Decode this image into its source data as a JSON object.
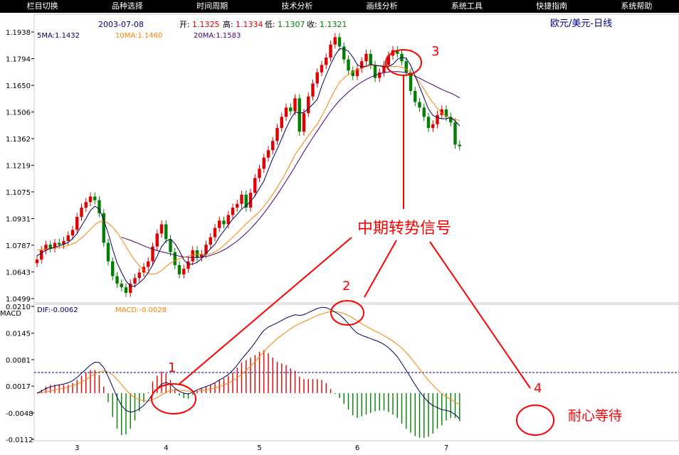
{
  "menu": [
    {
      "label": "栏目切换"
    },
    {
      "label": "品种选择"
    },
    {
      "label": "时间周期"
    },
    {
      "label": "技术分析"
    },
    {
      "label": "画线分析"
    },
    {
      "label": "系统工具"
    },
    {
      "label": "快捷指南"
    },
    {
      "label": "系统帮助"
    }
  ],
  "header": {
    "date": "2003-07-08",
    "open_label": "开:",
    "open_value": "1.1325",
    "high_label": "高:",
    "high_value": "1.1334",
    "low_label": "低:",
    "low_value": "1.1307",
    "close_label": "收:",
    "close_value": "1.1321",
    "title": "欧元/美元-日线"
  },
  "ma_legend": {
    "ma5": "5MA:1.1432",
    "ma10": "10MA:1.1460",
    "ma20": "20MA:1.1583"
  },
  "macd_legend": {
    "name": "MACD",
    "dif": "DIF:-0.0062",
    "macd": "MACD:-0.0028"
  },
  "annotations": {
    "signal_label": "中期转势信号",
    "wait_label": "耐心等待",
    "marker_1": "1",
    "marker_2": "2",
    "marker_3": "3",
    "marker_4": "4"
  },
  "colors": {
    "background": "#ffffff",
    "up_candle": "#e00000",
    "down_candle": "#008000",
    "ma5": "#000060",
    "ma10": "#ff8000",
    "ma20": "#400080",
    "dif": "#000060",
    "dea": "#ff8000",
    "annotation": "#ff0000",
    "grid": "#c8c8c8"
  },
  "chart_data": {
    "type": "candlestick",
    "price_axis": {
      "ticks": [
        "1.1938",
        "1.1794",
        "1.1650",
        "1.1506",
        "1.1362",
        "1.1219",
        "1.1075",
        "1.0931",
        "1.0787",
        "1.0643",
        "1.0499"
      ],
      "range": [
        1.0499,
        1.1938
      ]
    },
    "macd_axis": {
      "ticks": [
        "0.0210",
        "0.0145",
        "0.0081",
        "0.0017",
        "-0.0048",
        "-0.0112"
      ],
      "range": [
        -0.0112,
        0.021
      ]
    },
    "x_ticks": [
      "3",
      "4",
      "5",
      "6",
      "7"
    ],
    "x_tick_index": [
      9,
      29,
      50,
      72,
      92
    ],
    "close": [
      1.071,
      1.076,
      1.079,
      1.077,
      1.08,
      1.079,
      1.081,
      1.084,
      1.087,
      1.094,
      1.099,
      1.102,
      1.105,
      1.103,
      1.096,
      1.08,
      1.07,
      1.062,
      1.058,
      1.056,
      1.053,
      1.058,
      1.061,
      1.064,
      1.067,
      1.07,
      1.078,
      1.085,
      1.09,
      1.082,
      1.075,
      1.068,
      1.063,
      1.066,
      1.07,
      1.076,
      1.072,
      1.074,
      1.079,
      1.083,
      1.088,
      1.092,
      1.09,
      1.095,
      1.099,
      1.101,
      1.106,
      1.099,
      1.107,
      1.115,
      1.12,
      1.126,
      1.13,
      1.135,
      1.142,
      1.148,
      1.153,
      1.151,
      1.158,
      1.14,
      1.15,
      1.159,
      1.166,
      1.172,
      1.176,
      1.18,
      1.187,
      1.191,
      1.186,
      1.179,
      1.173,
      1.17,
      1.174,
      1.178,
      1.182,
      1.176,
      1.169,
      1.172,
      1.176,
      1.181,
      1.184,
      1.182,
      1.178,
      1.172,
      1.162,
      1.156,
      1.153,
      1.148,
      1.142,
      1.144,
      1.149,
      1.152,
      1.148,
      1.145,
      1.133,
      1.1321
    ],
    "ma5": [
      1.073,
      1.0745,
      1.076,
      1.077,
      1.0776,
      1.0784,
      1.0792,
      1.0802,
      1.0822,
      1.085,
      1.0892,
      1.0932,
      1.0974,
      1.0998,
      1.0982,
      1.0922,
      1.0852,
      1.0766,
      1.0692,
      1.064,
      1.0594,
      1.0566,
      1.0566,
      1.0584,
      1.0606,
      1.064,
      1.068,
      1.0728,
      1.078,
      1.081,
      1.082,
      1.0796,
      1.0756,
      1.0708,
      1.0684,
      1.0686,
      1.0694,
      1.0716,
      1.0742,
      1.0768,
      1.0792,
      1.0832,
      1.0864,
      1.0896,
      1.0928,
      1.0954,
      1.0982,
      1.1,
      1.1024,
      1.1054,
      1.1094,
      1.1134,
      1.1196,
      1.1256,
      1.1306,
      1.1362,
      1.1418,
      1.1468,
      1.1506,
      1.15,
      1.1504,
      1.1524,
      1.1548,
      1.1574,
      1.1646,
      1.1706,
      1.1762,
      1.1812,
      1.1848,
      1.1846,
      1.1834,
      1.1802,
      1.1762,
      1.1748,
      1.1754,
      1.1764,
      1.1758,
      1.1754,
      1.175,
      1.1752,
      1.1764,
      1.179,
      1.1802,
      1.1796,
      1.1758,
      1.17,
      1.1642,
      1.1582,
      1.1522,
      1.1488,
      1.1476,
      1.147,
      1.147,
      1.1476,
      1.1458,
      1.1432
    ],
    "ma10": [
      1.076,
      1.0762,
      1.0766,
      1.0768,
      1.0772,
      1.0776,
      1.078,
      1.0786,
      1.0794,
      1.0806,
      1.0826,
      1.0848,
      1.0872,
      1.0898,
      1.0914,
      1.0918,
      1.0906,
      1.0884,
      1.0856,
      1.082,
      1.078,
      1.074,
      1.0706,
      1.0676,
      1.0652,
      1.0634,
      1.063,
      1.0636,
      1.065,
      1.0672,
      1.069,
      1.0704,
      1.0714,
      1.0722,
      1.0728,
      1.0734,
      1.0738,
      1.0738,
      1.0736,
      1.074,
      1.075,
      1.0766,
      1.0786,
      1.0808,
      1.083,
      1.0854,
      1.0878,
      1.0902,
      1.0924,
      1.0946,
      1.0968,
      1.0996,
      1.1028,
      1.1062,
      1.11,
      1.114,
      1.1182,
      1.1228,
      1.1276,
      1.131,
      1.1344,
      1.1378,
      1.141,
      1.144,
      1.1484,
      1.153,
      1.158,
      1.1626,
      1.1666,
      1.169,
      1.1708,
      1.1722,
      1.1734,
      1.1742,
      1.175,
      1.1756,
      1.1758,
      1.1758,
      1.1756,
      1.1754,
      1.1752,
      1.1752,
      1.1748,
      1.1738,
      1.172,
      1.1696,
      1.1666,
      1.163,
      1.159,
      1.1556,
      1.1526,
      1.15,
      1.1484,
      1.1474,
      1.1466,
      1.146
    ],
    "ma20": [
      null,
      null,
      null,
      null,
      null,
      null,
      null,
      null,
      null,
      null,
      null,
      null,
      null,
      null,
      null,
      null,
      null,
      null,
      null,
      1.083,
      1.0822,
      1.0814,
      1.0804,
      1.0794,
      1.0784,
      1.0774,
      1.0766,
      1.0758,
      1.0752,
      1.0746,
      1.074,
      1.0734,
      1.0728,
      1.0724,
      1.0722,
      1.072,
      1.072,
      1.0722,
      1.0726,
      1.0732,
      1.074,
      1.075,
      1.0762,
      1.0776,
      1.0792,
      1.081,
      1.083,
      1.0852,
      1.0876,
      1.0902,
      1.093,
      1.096,
      1.0992,
      1.1026,
      1.106,
      1.1096,
      1.1134,
      1.1172,
      1.1212,
      1.1252,
      1.1292,
      1.133,
      1.1368,
      1.1404,
      1.144,
      1.1476,
      1.151,
      1.154,
      1.1568,
      1.1592,
      1.1614,
      1.1634,
      1.1652,
      1.1668,
      1.1682,
      1.1694,
      1.1704,
      1.1712,
      1.1718,
      1.1722,
      1.1724,
      1.1724,
      1.1722,
      1.1718,
      1.171,
      1.17,
      1.1688,
      1.1676,
      1.1664,
      1.1652,
      1.164,
      1.1628,
      1.1618,
      1.1608,
      1.1596,
      1.1583
    ],
    "dif": [
      0.0,
      0.0005,
      0.0011,
      0.0015,
      0.0018,
      0.002,
      0.0022,
      0.0025,
      0.003,
      0.0038,
      0.0048,
      0.0058,
      0.0068,
      0.0075,
      0.0074,
      0.0062,
      0.004,
      0.0015,
      -0.001,
      -0.003,
      -0.0042,
      -0.0046,
      -0.0044,
      -0.0038,
      -0.003,
      -0.0018,
      -0.0002,
      0.001,
      0.0022,
      0.0026,
      0.0022,
      0.0012,
      0.0004,
      0.0,
      -0.0002,
      0.0002,
      0.0008,
      0.0012,
      0.0016,
      0.002,
      0.0025,
      0.0032,
      0.0038,
      0.0045,
      0.0055,
      0.0068,
      0.0082,
      0.0095,
      0.0108,
      0.0122,
      0.0138,
      0.0152,
      0.016,
      0.0165,
      0.017,
      0.0176,
      0.0182,
      0.0186,
      0.019,
      0.0188,
      0.019,
      0.0195,
      0.02,
      0.0205,
      0.0208,
      0.0207,
      0.0202,
      0.0196,
      0.019,
      0.018,
      0.0168,
      0.0155,
      0.0145,
      0.014,
      0.0136,
      0.0132,
      0.0128,
      0.0124,
      0.0118,
      0.011,
      0.01,
      0.0088,
      0.0072,
      0.0055,
      0.0038,
      0.002,
      0.0004,
      -0.001,
      -0.0022,
      -0.003,
      -0.0035,
      -0.004,
      -0.0042,
      -0.0045,
      -0.0052,
      -0.0062
    ],
    "dea": [
      0.0,
      0.0001,
      0.0003,
      0.0005,
      0.0008,
      0.001,
      0.0012,
      0.0015,
      0.0018,
      0.0022,
      0.0027,
      0.0033,
      0.004,
      0.0047,
      0.0052,
      0.0054,
      0.0051,
      0.0044,
      0.0033,
      0.0021,
      0.0008,
      -0.0003,
      -0.0011,
      -0.0016,
      -0.0019,
      -0.0019,
      -0.0016,
      -0.0011,
      -0.0004,
      0.0002,
      0.0006,
      0.0007,
      0.0007,
      0.0006,
      0.0005,
      0.0004,
      0.0005,
      0.0006,
      0.0008,
      0.001,
      0.0013,
      0.0016,
      0.002,
      0.0024,
      0.003,
      0.0037,
      0.0045,
      0.0055,
      0.0065,
      0.0076,
      0.0088,
      0.01,
      0.0112,
      0.0122,
      0.0132,
      0.014,
      0.0148,
      0.0156,
      0.0163,
      0.0168,
      0.0173,
      0.0178,
      0.0183,
      0.0188,
      0.0192,
      0.0195,
      0.0197,
      0.0197,
      0.0196,
      0.0193,
      0.0188,
      0.0182,
      0.0175,
      0.0168,
      0.0162,
      0.0156,
      0.015,
      0.0145,
      0.0139,
      0.0133,
      0.0126,
      0.0118,
      0.0109,
      0.0098,
      0.0086,
      0.0072,
      0.0058,
      0.0044,
      0.0031,
      0.0019,
      0.0008,
      -0.0001,
      -0.0009,
      -0.0015,
      -0.0022,
      -0.0028
    ]
  }
}
